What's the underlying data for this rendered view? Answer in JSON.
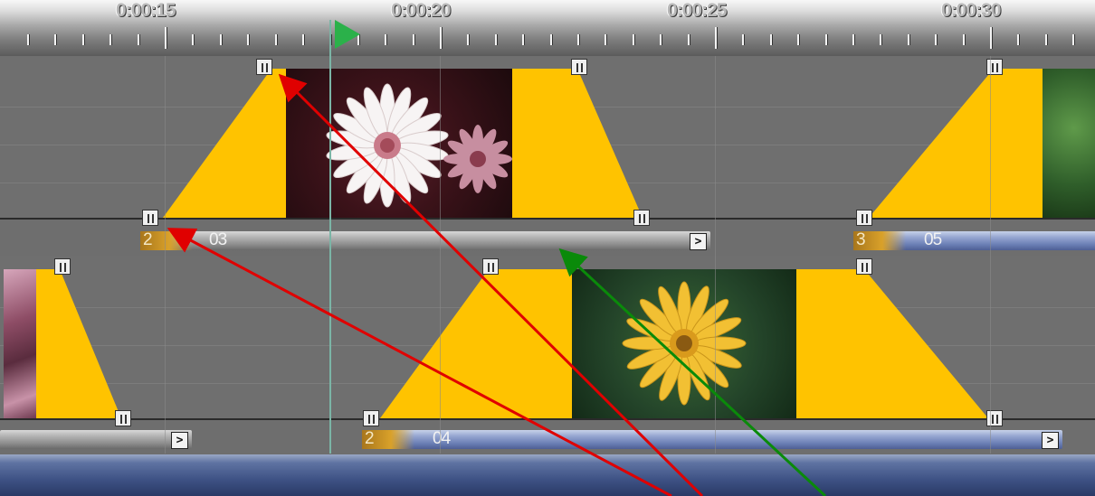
{
  "ruler": {
    "timecodes": [
      "0:00:15",
      "0:00:20",
      "0:00:25",
      "0:00:30"
    ]
  },
  "tracks": [
    {
      "clips": [
        {
          "number": "2",
          "name": "03",
          "end_button": ">",
          "bar_style": "gray"
        },
        {
          "number": "3",
          "name": "05",
          "end_button": "",
          "bar_style": "blue"
        }
      ]
    },
    {
      "clips": [
        {
          "number": "",
          "name": "",
          "end_button": ">",
          "bar_style": "gray"
        },
        {
          "number": "2",
          "name": "04",
          "end_button": ">",
          "bar_style": "blue"
        }
      ]
    }
  ],
  "colors": {
    "transition_fill": "#ffc300",
    "annotation_red": "#e00000",
    "annotation_green": "#0a8a0a",
    "playhead": "#2bb14a"
  },
  "icons": [
    "play-cursor-icon",
    "keyframe-handle-icon",
    "clip-end-arrow-icon"
  ]
}
